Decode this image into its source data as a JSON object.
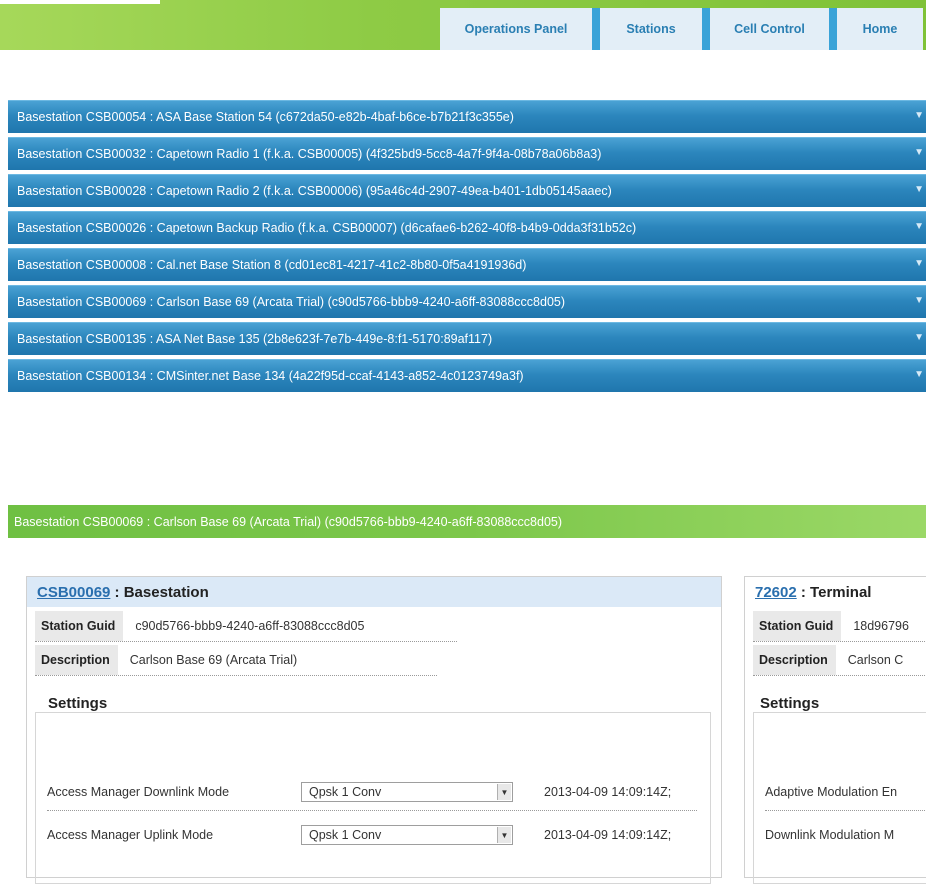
{
  "nav": {
    "tabs": [
      {
        "label": "Operations Panel"
      },
      {
        "label": "Stations"
      },
      {
        "label": "Cell Control"
      },
      {
        "label": "Home"
      }
    ]
  },
  "basestations": [
    "Basestation CSB00054 : ASA Base Station 54 (c672da50-e82b-4baf-b6ce-b7b21f3c355e)",
    "Basestation CSB00032 : Capetown Radio 1 (f.k.a. CSB00005) (4f325bd9-5cc8-4a7f-9f4a-08b78a06b8a3)",
    "Basestation CSB00028 : Capetown Radio 2 (f.k.a. CSB00006) (95a46c4d-2907-49ea-b401-1db05145aaec)",
    "Basestation CSB00026 : Capetown Backup Radio (f.k.a. CSB00007) (d6cafae6-b262-40f8-b4b9-0dda3f31b52c)",
    "Basestation CSB00008 : Cal.net Base Station 8 (cd01ec81-4217-41c2-8b80-0f5a4191936d)",
    "Basestation CSB00069 : Carlson Base 69 (Arcata Trial) (c90d5766-bbb9-4240-a6ff-83088ccc8d05)",
    "Basestation CSB00135 : ASA Net Base 135 (2b8e623f-7e7b-449e-8:f1-5170:89af117)",
    "Basestation CSB00134 : CMSinter.net Base 134 (4a22f95d-ccaf-4143-a852-4c0123749a3f)"
  ],
  "open_section": {
    "header": "Basestation CSB00069 : Carlson Base 69 (Arcata Trial) (c90d5766-bbb9-4240-a6ff-83088ccc8d05)"
  },
  "left_panel": {
    "id_link": "CSB00069",
    "type": " : Basestation",
    "guid_label": "Station Guid",
    "guid_value": "c90d5766-bbb9-4240-a6ff-83088ccc8d05",
    "desc_label": "Description",
    "desc_value": "Carlson Base 69 (Arcata Trial)",
    "settings_title": "Settings",
    "settings": [
      {
        "label": "Access Manager Downlink Mode",
        "value": "Qpsk 1 Conv",
        "timestamp": "2013-04-09 14:09:14Z;"
      },
      {
        "label": "Access Manager Uplink Mode",
        "value": "Qpsk 1 Conv",
        "timestamp": "2013-04-09 14:09:14Z;"
      }
    ]
  },
  "right_panel": {
    "id_link": "72602",
    "type": " : Terminal",
    "guid_label": "Station Guid",
    "guid_value": "18d96796",
    "desc_label": "Description",
    "desc_value": "Carlson C",
    "settings_title": "Settings",
    "settings": [
      {
        "label": "Adaptive Modulation En"
      },
      {
        "label": "Downlink Modulation M"
      }
    ]
  }
}
